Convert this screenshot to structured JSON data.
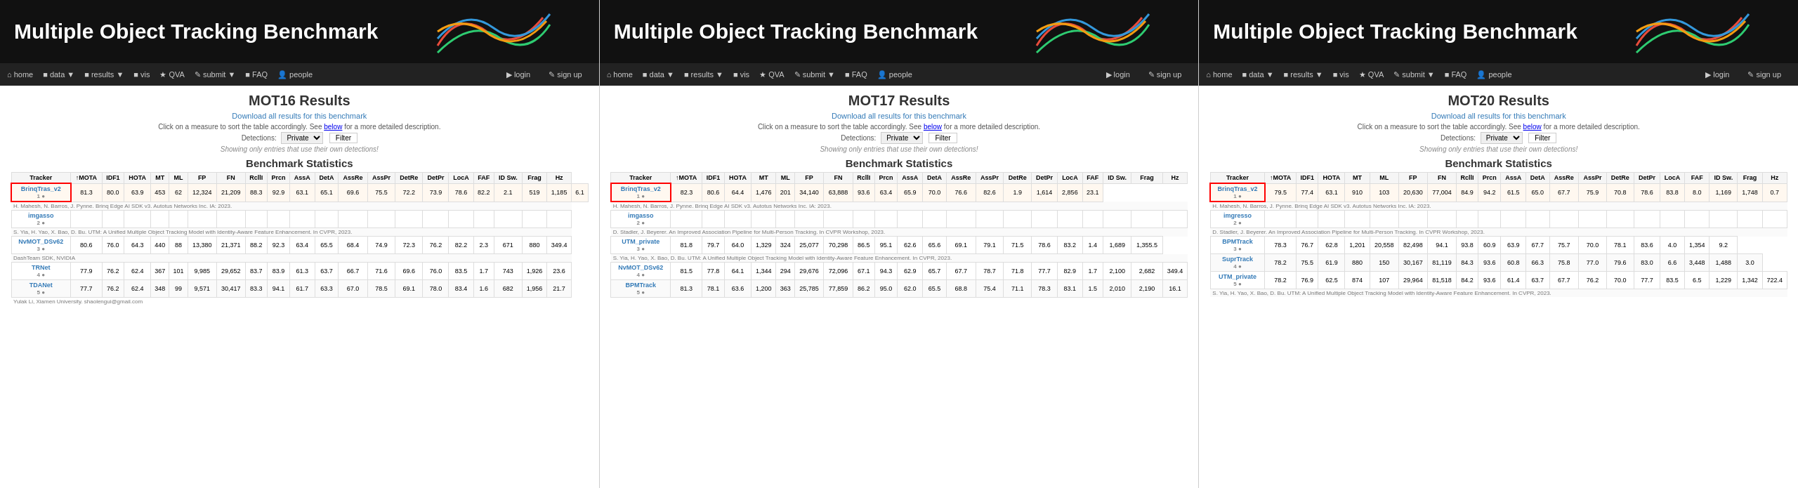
{
  "panels": [
    {
      "title": "Multiple Object Tracking Benchmark",
      "results_title": "MOT16 Results",
      "download_text": "Download all results for this benchmark",
      "filter_label": "Detections:",
      "filter_value": "Private",
      "filter_btn": "Filter",
      "own_detect": "Showing only entries that use their own detections!",
      "bench_title": "Benchmark Statistics",
      "columns": [
        "Tracker",
        "↑MOTA",
        "IDF1",
        "HOTA",
        "MT",
        "ML",
        "FP",
        "FN",
        "RcllI",
        "Prcn",
        "AssA",
        "DetA",
        "AssRe",
        "AssPr",
        "DetRe",
        "DetPr",
        "LocA",
        "FAF",
        "ID Sw.",
        "Frag",
        "Hz"
      ],
      "rows": [
        {
          "rank": "1",
          "name": "BrinqTras_v2",
          "vals": [
            "81.3",
            "80.0",
            "63.9",
            "453",
            "62",
            "12,324",
            "21,209",
            "88.3",
            "92.9",
            "63.1",
            "65.1",
            "69.6",
            "75.5",
            "72.2",
            "73.9",
            "78.6",
            "82.2",
            "2.1",
            "519",
            "1,185",
            "6.1"
          ],
          "cite": "H. Mahesh, N. Barros, J. Pynne. Brinq Edge AI SDK v3. Autotus Networks Inc. IA: 2023.",
          "highlight": true
        },
        {
          "rank": "2",
          "name": "imgasso",
          "vals": [
            "",
            "",
            "",
            "",
            "",
            "",
            "",
            "",
            "",
            "",
            "",
            "",
            "",
            "",
            "",
            "",
            "",
            "",
            "",
            ""
          ],
          "cite": "S. Yia, H. Yao, X. Bao, D. Bu. UTM: A Unified Multiple Object Tracking Model with Identity-Aware Feature Enhancement. In CVPR, 2023.",
          "highlight": false
        },
        {
          "rank": "3",
          "name": "NvMOT_DSv62",
          "vals": [
            "80.6",
            "76.0",
            "64.3",
            "440",
            "88",
            "13,380",
            "21,371",
            "88.2",
            "92.3",
            "63.4",
            "65.5",
            "68.4",
            "74.9",
            "72.3",
            "76.2",
            "82.2",
            "2.3",
            "671",
            "880",
            "349.4"
          ],
          "cite": "DashTeam SDK, NVIDIA",
          "highlight": false
        },
        {
          "rank": "4",
          "name": "TRNet",
          "vals": [
            "77.9",
            "76.2",
            "62.4",
            "367",
            "101",
            "9,985",
            "29,652",
            "83.7",
            "83.9",
            "61.3",
            "63.7",
            "66.7",
            "71.6",
            "69.6",
            "76.0",
            "83.5",
            "1.7",
            "743",
            "1,926",
            "23.6"
          ],
          "cite": "",
          "highlight": false
        },
        {
          "rank": "5",
          "name": "TDANet",
          "vals": [
            "77.7",
            "76.2",
            "62.4",
            "348",
            "99",
            "9,571",
            "30,417",
            "83.3",
            "94.1",
            "61.7",
            "63.3",
            "67.0",
            "78.5",
            "69.1",
            "78.0",
            "83.4",
            "1.6",
            "682",
            "1,956",
            "21.7"
          ],
          "cite": "Yulak Li, Xiamen University. shaolengui@gmail.com",
          "highlight": false
        }
      ]
    },
    {
      "title": "Multiple Object Tracking Benchmark",
      "results_title": "MOT17 Results",
      "download_text": "Download all results for this benchmark",
      "filter_label": "Detections:",
      "filter_value": "Private",
      "filter_btn": "Filter",
      "own_detect": "Showing only entries that use their own detections!",
      "bench_title": "Benchmark Statistics",
      "columns": [
        "Tracker",
        "↑MOTA",
        "IDF1",
        "HOTA",
        "MT",
        "ML",
        "FP",
        "FN",
        "RcllI",
        "Prcn",
        "AssA",
        "DetA",
        "AssRe",
        "AssPr",
        "DetRe",
        "DetPr",
        "LocA",
        "FAF",
        "ID Sw.",
        "Frag",
        "Hz"
      ],
      "rows": [
        {
          "rank": "1",
          "name": "BrinqTras_v2",
          "vals": [
            "82.3",
            "80.6",
            "64.4",
            "1,476",
            "201",
            "34,140",
            "63,888",
            "93.6",
            "63.4",
            "65.9",
            "70.0",
            "76.6",
            "82.6",
            "1.9",
            "1,614",
            "2,856",
            "23.1"
          ],
          "cite": "H. Mahesh, N. Barros, J. Pynne. Brinq Edge AI SDK v3. Autotus Networks Inc. IA: 2023.",
          "highlight": true
        },
        {
          "rank": "2",
          "name": "imgasso",
          "vals": [
            "",
            "",
            "",
            "",
            "",
            "",
            "",
            "",
            "",
            "",
            "",
            "",
            "",
            "",
            "",
            "",
            "",
            "",
            "",
            ""
          ],
          "cite": "D. Stadler, J. Beyerer. An Improved Association Pipeline for Multi-Person Tracking. In CVPR Workshop, 2023.",
          "highlight": false
        },
        {
          "rank": "3",
          "name": "UTM_private",
          "vals": [
            "81.8",
            "79.7",
            "64.0",
            "1,329",
            "324",
            "25,077",
            "70,298",
            "86.5",
            "95.1",
            "62.6",
            "65.6",
            "69.1",
            "79.1",
            "71.5",
            "78.6",
            "83.2",
            "1.4",
            "1,689",
            "1,355.5"
          ],
          "cite": "S. Yia, H. Yao, X. Bao, D. Bu. UTM: A Unified Multiple Object Tracking Model with Identity-Aware Feature Enhancement. In CVPR, 2023.",
          "highlight": false
        },
        {
          "rank": "4",
          "name": "NvMOT_DSv62",
          "vals": [
            "81.5",
            "77.8",
            "64.1",
            "1,344",
            "294",
            "29,676",
            "72,096",
            "67.1",
            "94.3",
            "62.9",
            "65.7",
            "67.7",
            "78.7",
            "71.8",
            "77.7",
            "82.9",
            "1.7",
            "2,100",
            "2,682",
            "349.4"
          ],
          "cite": "",
          "highlight": false
        },
        {
          "rank": "5",
          "name": "BPMTrack",
          "vals": [
            "81.3",
            "78.1",
            "63.6",
            "1,200",
            "363",
            "25,785",
            "77,859",
            "86.2",
            "95.0",
            "62.0",
            "65.5",
            "68.8",
            "75.4",
            "71.1",
            "78.3",
            "83.1",
            "1.5",
            "2,010",
            "2,190",
            "16.1"
          ],
          "cite": "",
          "highlight": false
        }
      ]
    },
    {
      "title": "Multiple Object Tracking Benchmark",
      "results_title": "MOT20 Results",
      "download_text": "Download all results for this benchmark",
      "filter_label": "Detections:",
      "filter_value": "Private",
      "filter_btn": "Filter",
      "own_detect": "Showing only entries that use their own detections!",
      "bench_title": "Benchmark Statistics",
      "columns": [
        "Tracker",
        "↑MOTA",
        "IDF1",
        "HOTA",
        "MT",
        "ML",
        "FP",
        "FN",
        "RcllI",
        "Prcn",
        "AssA",
        "DetA",
        "AssRe",
        "AssPr",
        "DetRe",
        "DetPr",
        "LocA",
        "FAF",
        "ID Sw.",
        "Frag",
        "Hz"
      ],
      "rows": [
        {
          "rank": "1",
          "name": "BrinqTras_v2",
          "vals": [
            "79.5",
            "77.4",
            "63.1",
            "910",
            "103",
            "20,630",
            "77,004",
            "84.9",
            "94.2",
            "61.5",
            "65.0",
            "67.7",
            "75.9",
            "70.8",
            "78.6",
            "83.8",
            "8.0",
            "1,169",
            "1,748",
            "0.7"
          ],
          "cite": "H. Mahesh, N. Barros, J. Pynne. Brinq Edge AI SDK v3. Autotus Networks Inc. IA: 2023.",
          "highlight": true
        },
        {
          "rank": "2",
          "name": "imgresso",
          "vals": [
            "",
            "",
            "",
            "",
            "",
            "",
            "",
            "",
            "",
            "",
            "",
            "",
            "",
            "",
            "",
            "",
            "",
            "",
            "",
            ""
          ],
          "cite": "D. Stadler, J. Beyerer. An Improved Association Pipeline for Multi-Person Tracking. In CVPR Workshop, 2023.",
          "highlight": false
        },
        {
          "rank": "3",
          "name": "BPMTrack",
          "vals": [
            "78.3",
            "76.7",
            "62.8",
            "1,201",
            "20,558",
            "82,498",
            "94.1",
            "93.8",
            "60.9",
            "63.9",
            "67.7",
            "75.7",
            "70.0",
            "78.1",
            "83.6",
            "4.0",
            "1,354",
            "9.2"
          ],
          "cite": "",
          "highlight": false
        },
        {
          "rank": "4",
          "name": "SuprTrack",
          "vals": [
            "78.2",
            "75.5",
            "61.9",
            "880",
            "150",
            "30,167",
            "81,119",
            "84.3",
            "93.6",
            "60.8",
            "66.3",
            "75.8",
            "77.0",
            "79.6",
            "83.0",
            "6.6",
            "3,448",
            "1,488",
            "3.0"
          ],
          "cite": "",
          "highlight": false
        },
        {
          "rank": "5",
          "name": "UTM_private",
          "vals": [
            "78.2",
            "76.9",
            "62.5",
            "874",
            "107",
            "29,964",
            "81,518",
            "84.2",
            "93.6",
            "61.4",
            "63.7",
            "67.7",
            "76.2",
            "70.0",
            "77.7",
            "83.5",
            "6.5",
            "1,229",
            "1,342",
            "722.4"
          ],
          "cite": "S. Yia, H. Yao, X. Bao, D. Bu. UTM: A Unified Multiple Object Tracking Model with Identity-Aware Feature Enhancement. In CVPR, 2023.",
          "highlight": false
        }
      ]
    }
  ],
  "nav": {
    "home": "home",
    "data": "data",
    "results": "results",
    "vis": "vis",
    "qva": "QVA",
    "submit": "submit",
    "faq": "FAQ",
    "people": "people",
    "login": "login",
    "signup": "sign up"
  }
}
